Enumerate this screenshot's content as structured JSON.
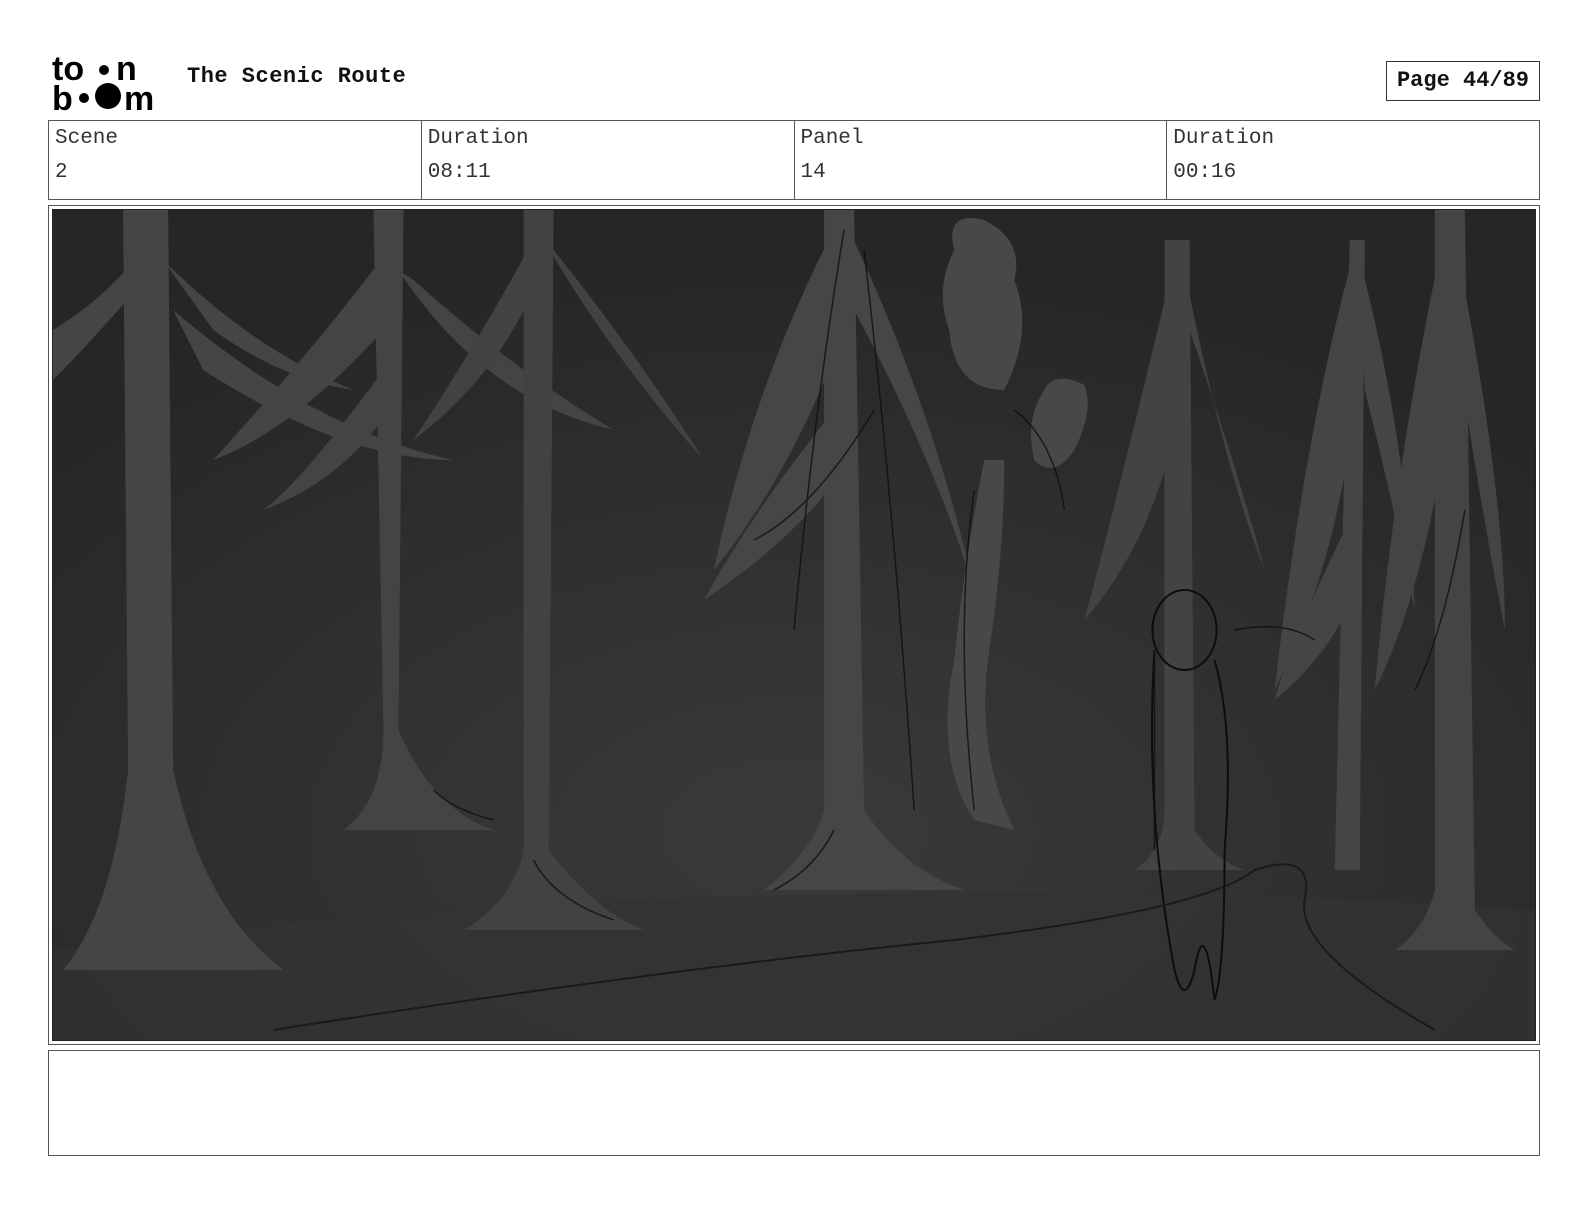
{
  "header": {
    "logo": {
      "icon": "toon-boom-logo",
      "top_text": "to",
      "top_tail": "n",
      "bottom_start": "b",
      "bottom_end": "m"
    },
    "project_title": "The Scenic Route",
    "page_label": "Page 44/89"
  },
  "info": {
    "scene_label": "Scene",
    "scene_value": "2",
    "scene_duration_label": "Duration",
    "scene_duration_value": "08:11",
    "panel_label": "Panel",
    "panel_value": "14",
    "panel_duration_label": "Duration",
    "panel_duration_value": "00:16"
  },
  "panel": {
    "icon": "dark-forest-sketch",
    "background_color": "#2b2b2b",
    "tree_color": "#444444",
    "line_color": "#0d0d0d"
  },
  "notes": {
    "text": ""
  }
}
